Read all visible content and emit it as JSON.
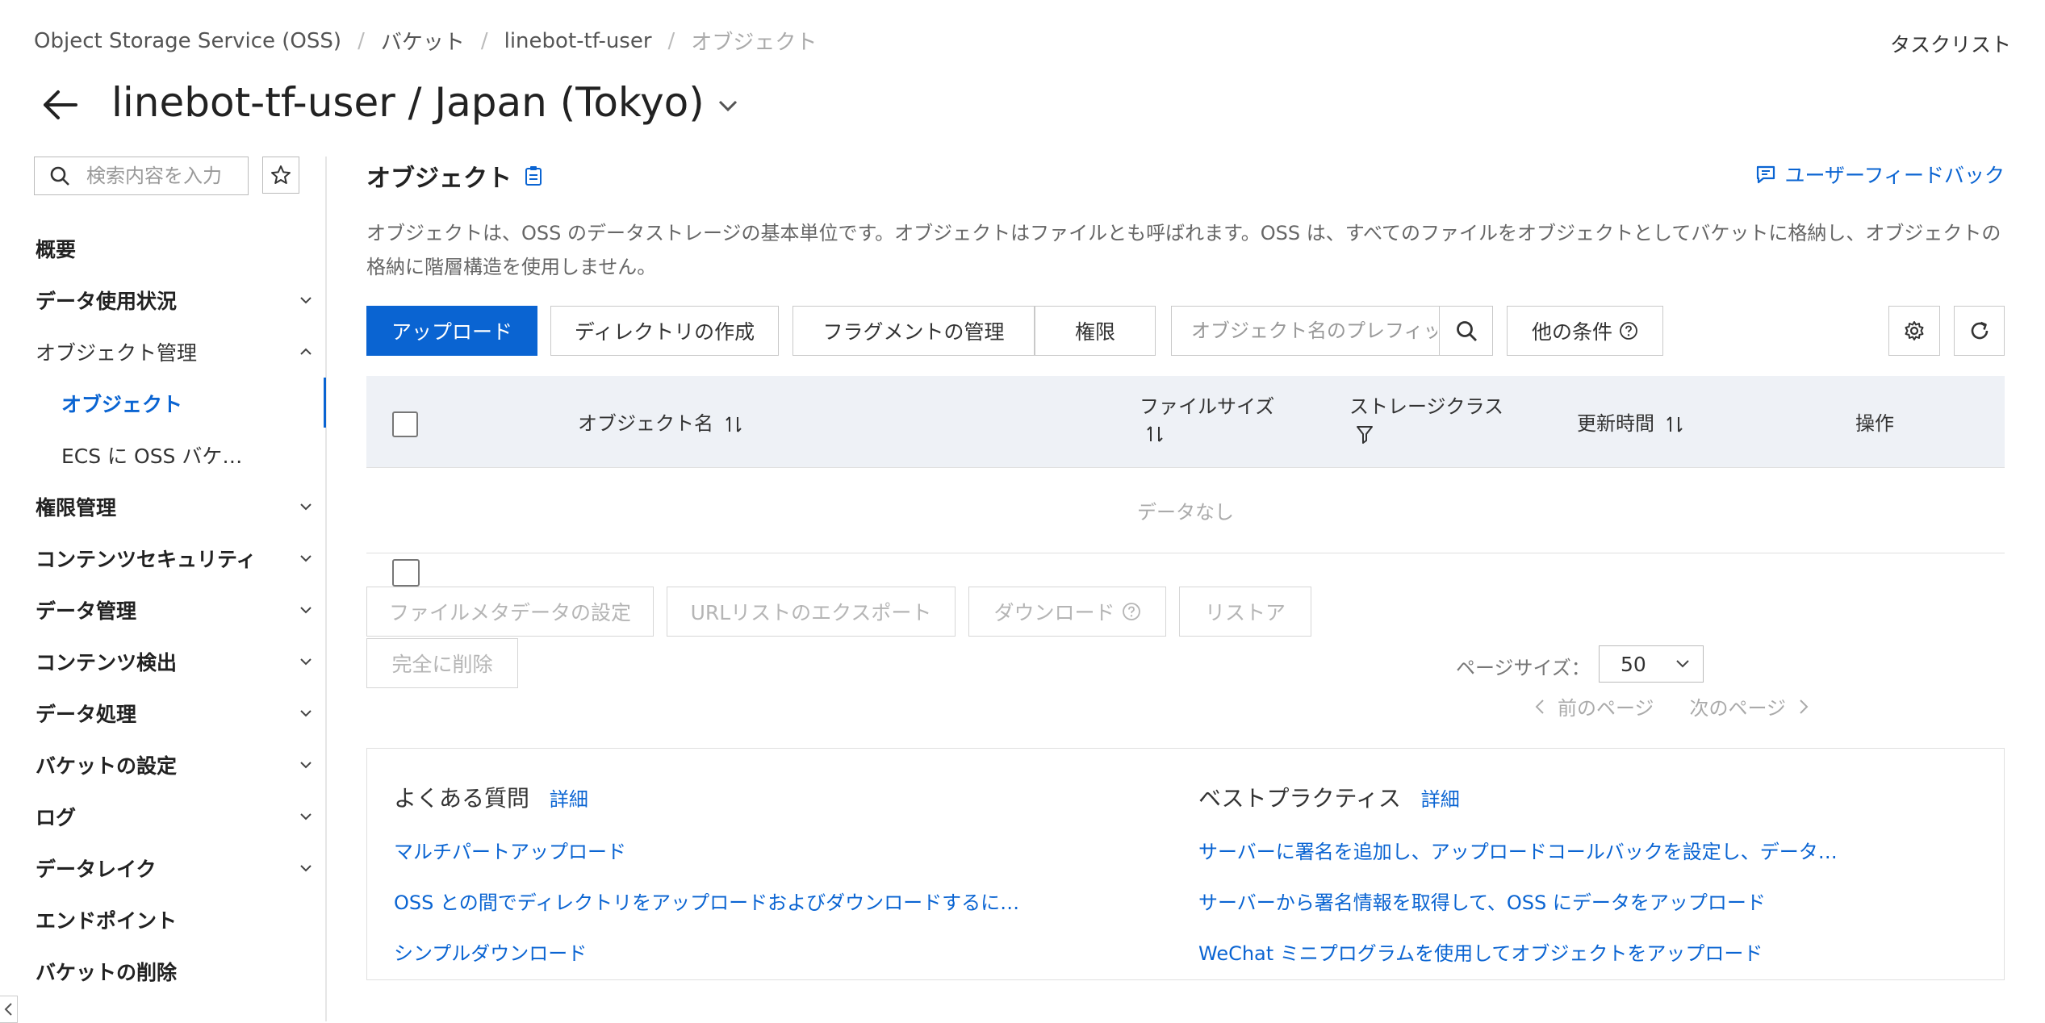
{
  "breadcrumb": [
    "Object Storage Service (OSS)",
    "バケット",
    "linebot-tf-user",
    "オブジェクト"
  ],
  "header": {
    "tasklist": "タスクリスト",
    "title": "linebot-tf-user / Japan (Tokyo)"
  },
  "sidebar": {
    "search_placeholder": "検索内容を入力",
    "items": [
      {
        "label": "概要"
      },
      {
        "label": "データ使用状況"
      },
      {
        "label": "オブジェクト管理"
      },
      {
        "label": "オブジェクト"
      },
      {
        "label": "ECS に OSS バケ…"
      },
      {
        "label": "権限管理"
      },
      {
        "label": "コンテンツセキュリティ"
      },
      {
        "label": "データ管理"
      },
      {
        "label": "コンテンツ検出"
      },
      {
        "label": "データ処理"
      },
      {
        "label": "バケットの設定"
      },
      {
        "label": "ログ"
      },
      {
        "label": "データレイク"
      },
      {
        "label": "エンドポイント"
      },
      {
        "label": "バケットの削除"
      }
    ]
  },
  "main": {
    "section_title": "オブジェクト",
    "feedback": "ユーザーフィードバック",
    "description": "オブジェクトは、OSS のデータストレージの基本単位です。オブジェクトはファイルとも呼ばれます。OSS は、すべてのファイルをオブジェクトとしてバケットに格納し、オブジェクトの格納に階層構造を使用しません。",
    "toolbar": {
      "upload": "アップロード",
      "create_dir": "ディレクトリの作成",
      "fragments": "フラグメントの管理",
      "permissions": "権限",
      "search_placeholder": "オブジェクト名のプレフィックス",
      "other_conditions": "他の条件"
    },
    "table": {
      "columns": {
        "name": "オブジェクト名",
        "size": "ファイルサイズ",
        "storage_class": "ストレージクラス",
        "updated": "更新時間",
        "actions": "操作"
      },
      "empty": "データなし"
    },
    "bulk_actions": {
      "metadata": "ファイルメタデータの設定",
      "export_urls": "URLリストのエクスポート",
      "download": "ダウンロード",
      "restore": "リストア",
      "delete_permanently": "完全に削除"
    },
    "pagination": {
      "page_size_label": "ページサイズ：",
      "page_size": "50",
      "prev": "前のページ",
      "next": "次のページ"
    },
    "faq": {
      "title": "よくある質問",
      "more": "詳細",
      "links": [
        "マルチパートアップロード",
        "OSS との間でディレクトリをアップロードおよびダウンロードするに…",
        "シンプルダウンロード"
      ]
    },
    "best_practices": {
      "title": "ベストプラクティス",
      "more": "詳細",
      "links": [
        "サーバーに署名を追加し、アップロードコールバックを設定し、データ…",
        "サーバーから署名情報を取得して、OSS にデータをアップロード",
        "WeChat ミニプログラムを使用してオブジェクトをアップロード"
      ]
    }
  },
  "colors": {
    "accent": "#0a64d2",
    "table_header_bg": "#eef1f6"
  }
}
